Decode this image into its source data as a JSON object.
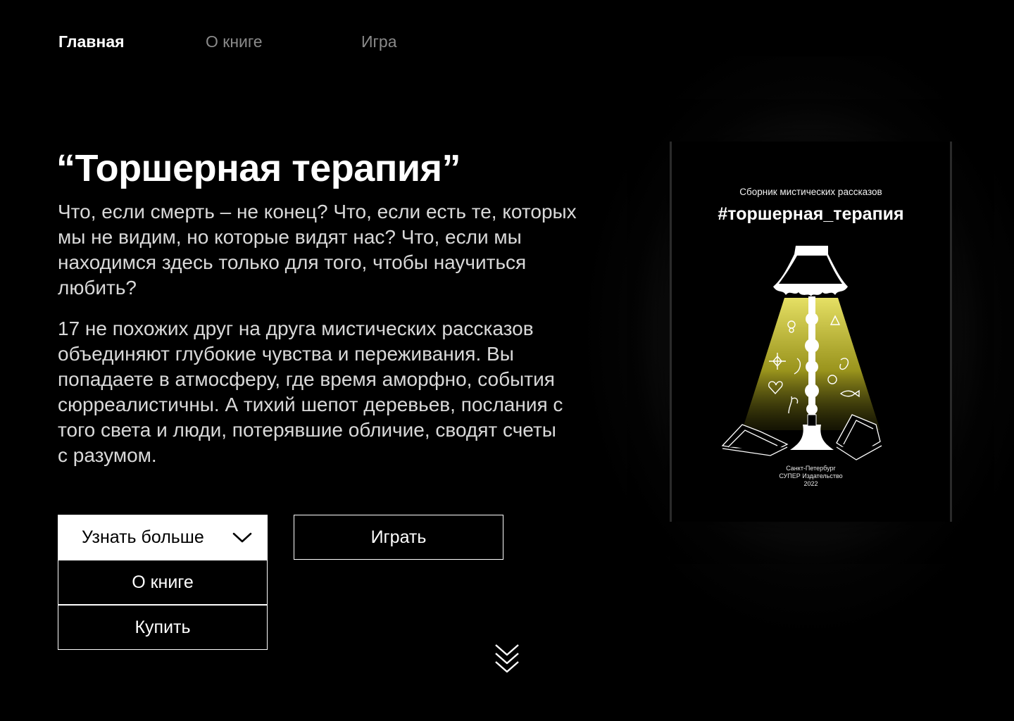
{
  "nav": {
    "items": [
      {
        "label": "Главная",
        "active": true
      },
      {
        "label": "О книге",
        "active": false
      },
      {
        "label": "Игра",
        "active": false
      }
    ]
  },
  "hero": {
    "title": "“Торшерная терапия”",
    "paragraph_1": "Что, если смерть – не конец? Что, если есть те, которых мы не видим, но которые видят нас? Что, если мы находимся здесь только для того, чтобы научиться любить?",
    "paragraph_2": "17 не похожих друг на друга мистических рассказов объединяют глубокие чувства и переживания. Вы попадаете в атмосферу, где время аморфно, события сюрреалистичны. А тихий шепот деревьев, послания с того света и люди, потерявшие обличие, сводят счеты с разумом."
  },
  "actions": {
    "learn_more_label": "Узнать больше",
    "dropdown_items": [
      "О книге",
      "Купить"
    ],
    "play_label": "Играть"
  },
  "book_cover": {
    "subtitle": "Сборник мистических рассказов",
    "title": "#торшерная_терапия",
    "imprint_city": "Санкт-Петербург",
    "imprint_publisher": "СУПЕР Издательство",
    "imprint_year": "2022"
  },
  "icons": {
    "dropdown": "chevron-down-icon",
    "scroll": "double-chevron-down-icon"
  },
  "colors": {
    "background": "#000000",
    "text": "#ffffff",
    "muted_nav": "#8a8a8a",
    "body_text": "#d9d9d9",
    "lamp_light": "#d8d23a"
  }
}
